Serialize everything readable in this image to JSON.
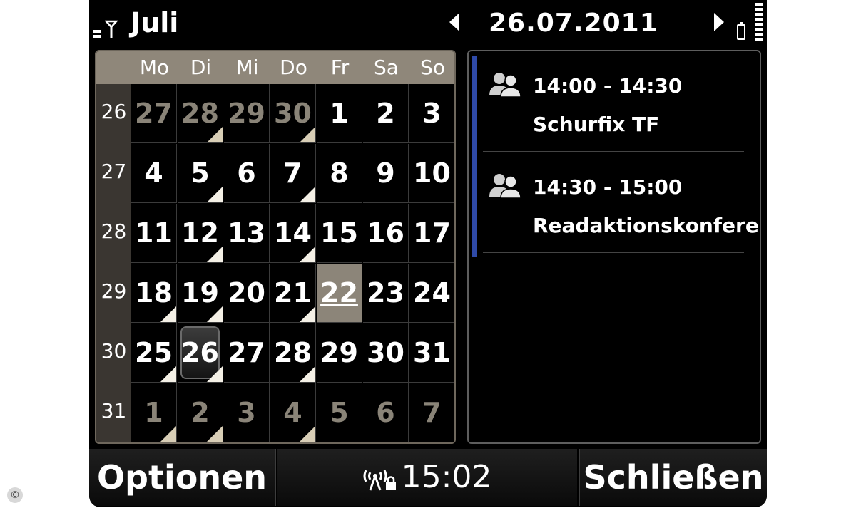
{
  "header": {
    "month": "Juli",
    "date": "26.07.2011"
  },
  "calendar": {
    "day_names": [
      "Mo",
      "Di",
      "Mi",
      "Do",
      "Fr",
      "Sa",
      "So"
    ],
    "weeks": [
      {
        "num": "26",
        "days": [
          {
            "d": "27",
            "dim": true,
            "mark": false
          },
          {
            "d": "28",
            "dim": true,
            "mark": true
          },
          {
            "d": "29",
            "dim": true,
            "mark": false
          },
          {
            "d": "30",
            "dim": true,
            "mark": true
          },
          {
            "d": "1",
            "dim": false,
            "mark": false
          },
          {
            "d": "2",
            "dim": false,
            "mark": false
          },
          {
            "d": "3",
            "dim": false,
            "mark": false
          }
        ]
      },
      {
        "num": "27",
        "days": [
          {
            "d": "4",
            "dim": false,
            "mark": false
          },
          {
            "d": "5",
            "dim": false,
            "mark": true
          },
          {
            "d": "6",
            "dim": false,
            "mark": false
          },
          {
            "d": "7",
            "dim": false,
            "mark": true
          },
          {
            "d": "8",
            "dim": false,
            "mark": false
          },
          {
            "d": "9",
            "dim": false,
            "mark": false
          },
          {
            "d": "10",
            "dim": false,
            "mark": false
          }
        ]
      },
      {
        "num": "28",
        "days": [
          {
            "d": "11",
            "dim": false,
            "mark": false
          },
          {
            "d": "12",
            "dim": false,
            "mark": true
          },
          {
            "d": "13",
            "dim": false,
            "mark": false
          },
          {
            "d": "14",
            "dim": false,
            "mark": true
          },
          {
            "d": "15",
            "dim": false,
            "mark": false
          },
          {
            "d": "16",
            "dim": false,
            "mark": false
          },
          {
            "d": "17",
            "dim": false,
            "mark": false
          }
        ]
      },
      {
        "num": "29",
        "days": [
          {
            "d": "18",
            "dim": false,
            "mark": true
          },
          {
            "d": "19",
            "dim": false,
            "mark": true
          },
          {
            "d": "20",
            "dim": false,
            "mark": false
          },
          {
            "d": "21",
            "dim": false,
            "mark": true
          },
          {
            "d": "22",
            "dim": false,
            "mark": false,
            "today": true
          },
          {
            "d": "23",
            "dim": false,
            "mark": false
          },
          {
            "d": "24",
            "dim": false,
            "mark": false
          }
        ]
      },
      {
        "num": "30",
        "days": [
          {
            "d": "25",
            "dim": false,
            "mark": true
          },
          {
            "d": "26",
            "dim": false,
            "mark": true,
            "selected": true
          },
          {
            "d": "27",
            "dim": false,
            "mark": false
          },
          {
            "d": "28",
            "dim": false,
            "mark": true
          },
          {
            "d": "29",
            "dim": false,
            "mark": false
          },
          {
            "d": "30",
            "dim": false,
            "mark": false
          },
          {
            "d": "31",
            "dim": false,
            "mark": false
          }
        ]
      },
      {
        "num": "31",
        "days": [
          {
            "d": "1",
            "dim": true,
            "mark": true
          },
          {
            "d": "2",
            "dim": true,
            "mark": true
          },
          {
            "d": "3",
            "dim": true,
            "mark": false
          },
          {
            "d": "4",
            "dim": true,
            "mark": true
          },
          {
            "d": "5",
            "dim": true,
            "mark": false
          },
          {
            "d": "6",
            "dim": true,
            "mark": false
          },
          {
            "d": "7",
            "dim": true,
            "mark": false
          }
        ]
      }
    ]
  },
  "events": [
    {
      "time": "14:00 - 14:30",
      "title": "Schurfix TF",
      "icon": "people-icon"
    },
    {
      "time": "14:30 - 15:00",
      "title": "Readaktionskonfere...",
      "icon": "people-icon"
    }
  ],
  "softkeys": {
    "left": "Optionen",
    "clock": "15:02",
    "right": "Schließen"
  },
  "colors": {
    "background": "#000000",
    "header_row": "#8f877a",
    "today_cell": "#8c8579",
    "event_bar": "#2f4aa8"
  },
  "copyright_symbol": "©"
}
